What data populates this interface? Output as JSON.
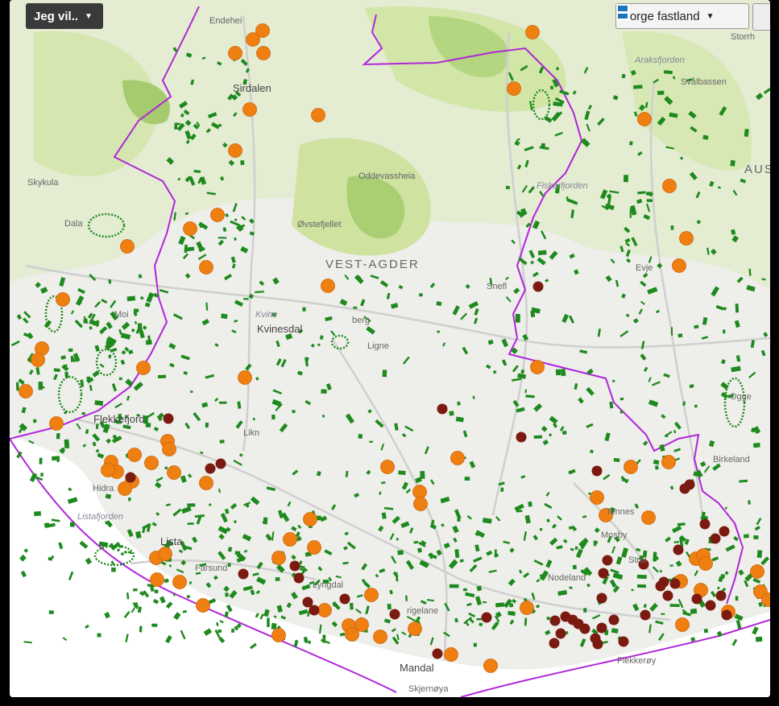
{
  "toolbar": {
    "menu_label": "Jeg vil..",
    "region_label": "Norge fastland"
  },
  "labels": {
    "sirdalen": "Sirdalen",
    "vest_agder": "VEST-AGDER",
    "kvinesdal": "Kvinesdal",
    "flekkefjord": "Flekkefjord",
    "lista": "Lista",
    "farsund": "Farsund",
    "lyngdal": "Lyngdal",
    "mandal": "Mandal",
    "skjernoya": "Skjernøya",
    "evje": "Evje",
    "birkeland": "Birkeland",
    "mosby": "Mosby",
    "ogge": "Ogge",
    "oddevassheia": "Oddevassheia",
    "ovstefjellet": "Øvstefjellet",
    "fiskarfjorden": "Fiskarfjorden",
    "aust": "AUS",
    "hidra": "Hidra",
    "listafjorden": "Listafjorden",
    "endehei": "Endehei",
    "storrh": "Storrh",
    "svalbassen": "Svålbassen",
    "araksfjorden": "Araksfjorden",
    "dala": "Dala",
    "moi": "Moi",
    "skykula": "Skykula",
    "berg": "berg",
    "snefl": "Snefl",
    "ligne": "Ligne",
    "likn": "Likn",
    "kvine": "Kvine",
    "flekkeroy": "Flekkerøy",
    "gelaneni": "rigelane",
    "nodeland": "Nodeland",
    "strai": "Strai",
    "tennes": "Tennes"
  },
  "icons": {
    "menu": "chevron-down-icon",
    "region": "norway-flag-icon"
  },
  "colors": {
    "orange_marker": "#f07f12",
    "darkred_marker": "#7b1a10",
    "green_area": "#1e8a1e",
    "boundary": "#b026d8"
  }
}
